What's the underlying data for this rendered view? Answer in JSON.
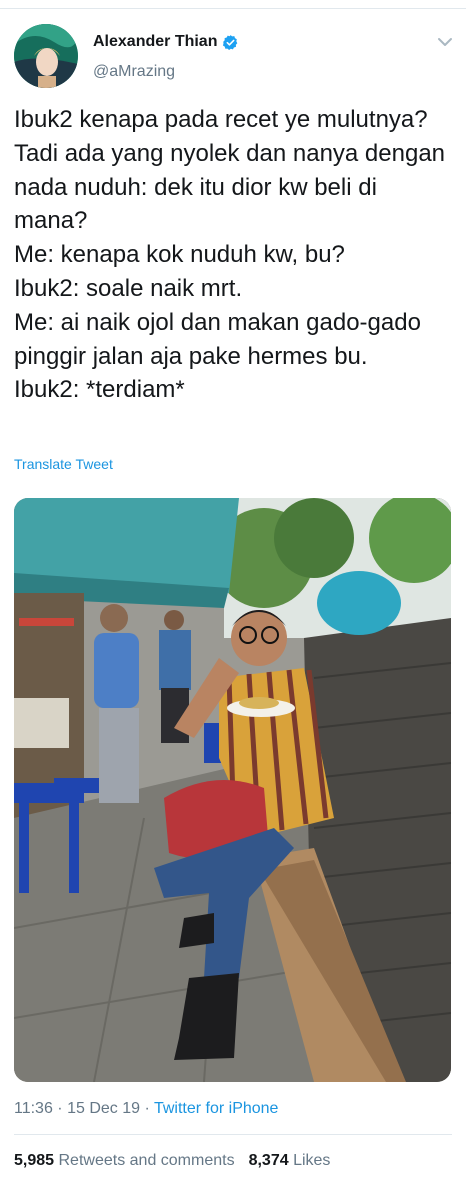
{
  "author": {
    "display_name": "Alexander Thian",
    "handle": "@aMrazing",
    "verified": true
  },
  "tweet": {
    "text": "Ibuk2 kenapa pada recet ye mulutnya? Tadi ada yang nyolek dan nanya dengan nada nuduh: dek itu dior kw beli di mana?\nMe: kenapa kok nuduh kw, bu?\nIbuk2: soale naik mrt.\nMe: ai naik ojol dan makan gado-gado pinggir jalan aja pake hermes bu.\nIbuk2: *terdiam*",
    "translate_label": "Translate Tweet"
  },
  "meta": {
    "time": "11:36",
    "separator": " · ",
    "date": "15 Dec 19",
    "source": "Twitter for iPhone"
  },
  "stats": {
    "retweets_count": "5,985",
    "retweets_label": "Retweets and comments",
    "likes_count": "8,374",
    "likes_label": "Likes"
  },
  "icons": {
    "verified": "verified-badge-icon",
    "more": "chevron-down-icon"
  },
  "colors": {
    "link": "#1b95e0",
    "secondary_text": "#657786",
    "verified": "#1da1f2",
    "divider": "#e1e8ed"
  }
}
